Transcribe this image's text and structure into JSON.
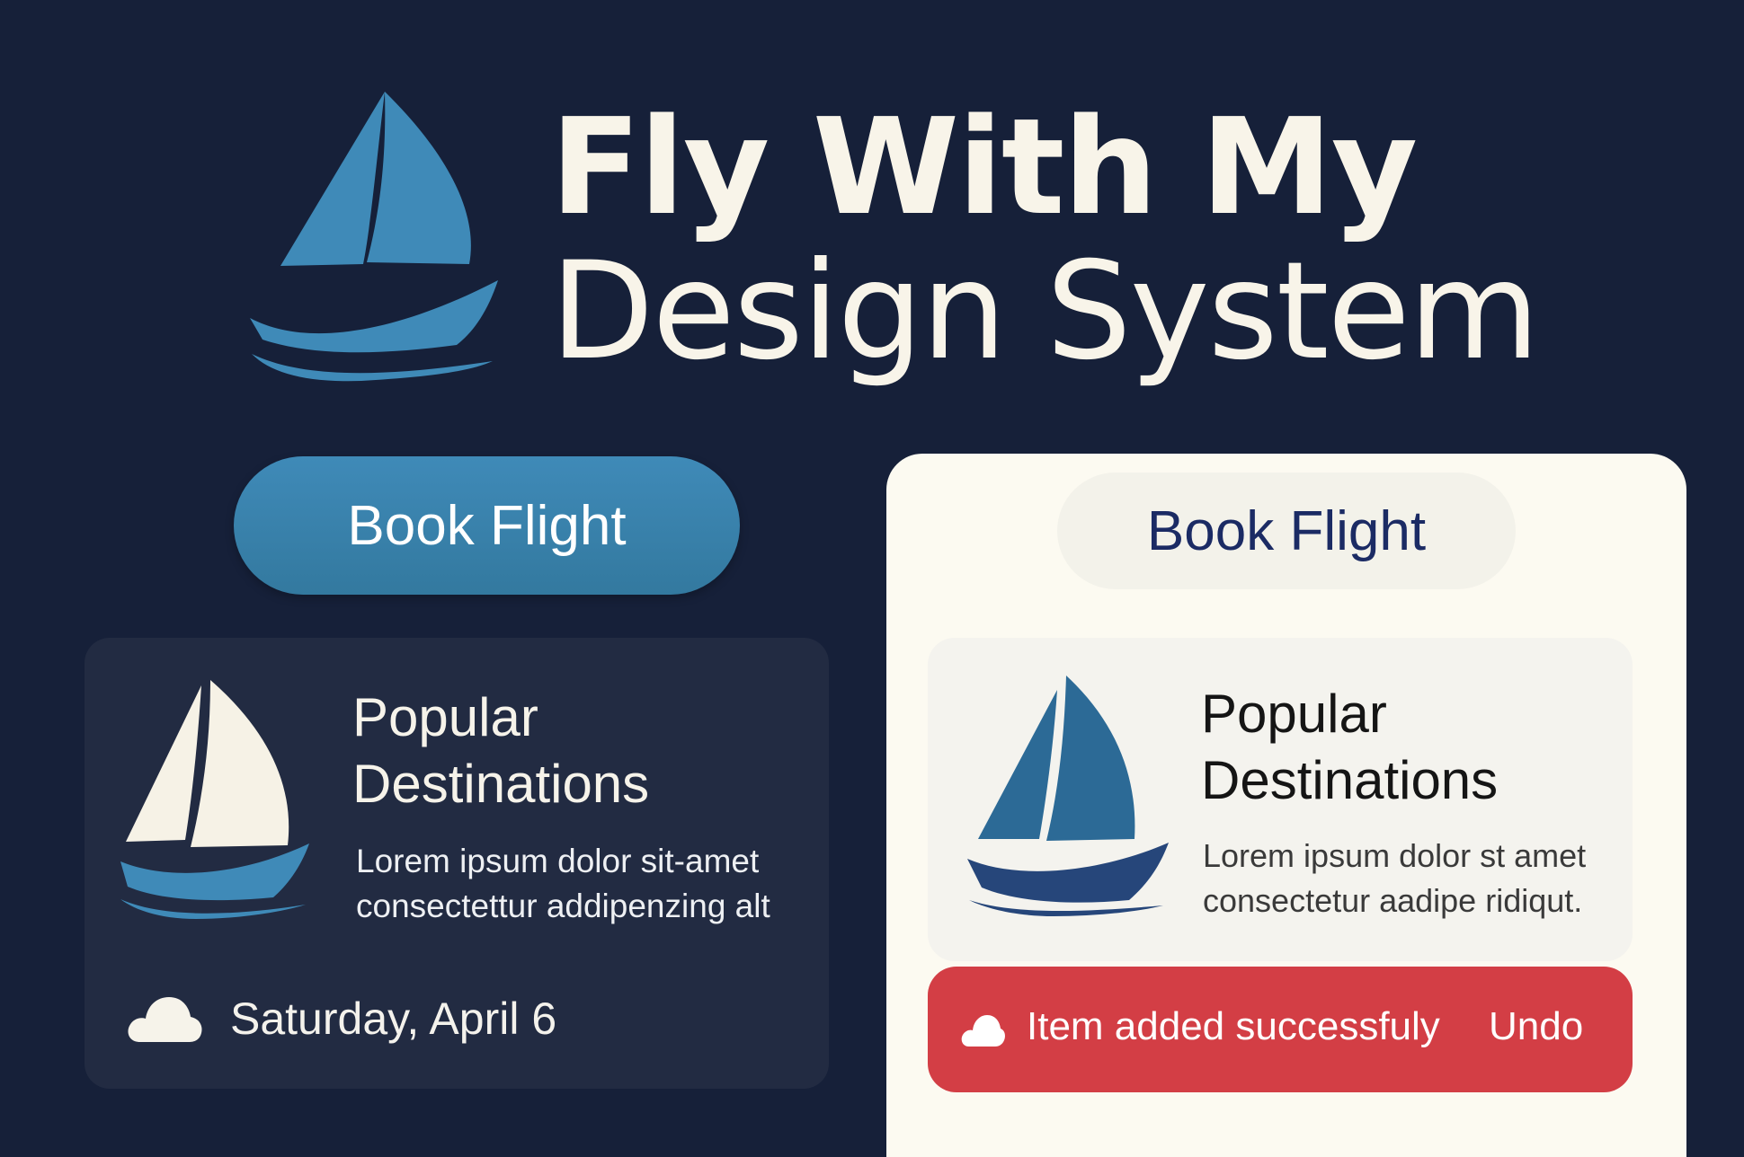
{
  "header": {
    "title_line_1": "Fly With My",
    "title_line_2": "Design System"
  },
  "dark_theme": {
    "book_button_label": "Book Flight",
    "card": {
      "title_line_1": "Popular",
      "title_line_2": "Destinations",
      "body_line_1": "Lorem ipsum dolor sit-amet",
      "body_line_2": "consectettur addipenzing alt"
    },
    "date": "Saturday, April 6"
  },
  "light_theme": {
    "book_button_label": "Book Flight",
    "card": {
      "title_line_1": "Popular",
      "title_line_2": "Destinations",
      "body_line_1": "Lorem ipsum dolor st amet",
      "body_line_2": "consectetur aadipe ridiqut."
    },
    "toast": {
      "message": "Item added successfuly",
      "action_label": "Undo"
    }
  },
  "icons": {
    "logo": "sailboat-icon",
    "card": "sailboat-icon",
    "weather": "cloud-icon"
  },
  "colors": {
    "background": "#162039",
    "accent_blue": "#3f8ab8",
    "navy_text": "#1b2b64",
    "toast_red": "#d33e45",
    "cream": "#fcfaf1",
    "dark_card": "#222b42"
  }
}
